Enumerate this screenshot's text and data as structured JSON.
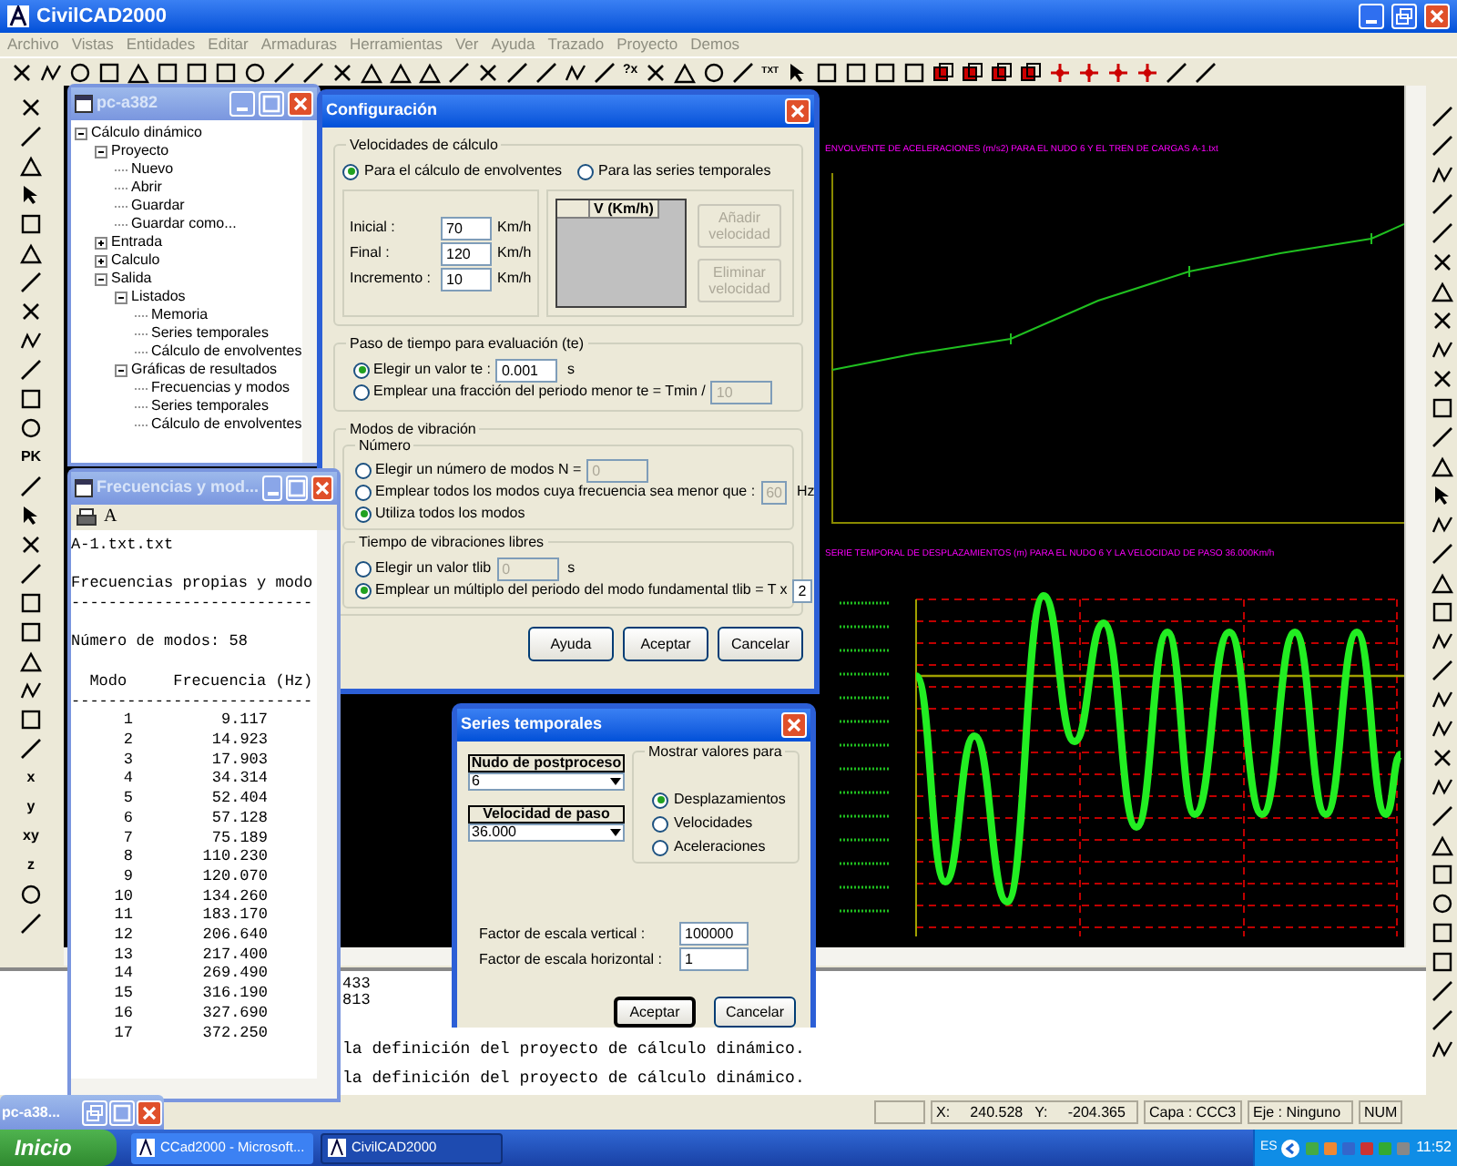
{
  "app": {
    "title": "CivilCAD2000"
  },
  "menu": [
    "Archivo",
    "Vistas",
    "Entidades",
    "Editar",
    "Armaduras",
    "Herramientas",
    "Ver",
    "Ayuda",
    "Trazado",
    "Proyecto",
    "Demos"
  ],
  "toolbar_labels": [
    "?x",
    "TXT"
  ],
  "left_toolbar_labels": [
    "PK",
    "x",
    "y",
    "xy",
    "z"
  ],
  "charts": [
    {
      "title": "ENVOLVENTE DE ACELERACIONES (m/s2) PARA EL NUDO 6 Y EL TREN DE CARGAS A-1.txt",
      "kind": "envelope"
    },
    {
      "title": "SERIE TEMPORAL DE DESPLAZAMIENTOS (m) PARA EL NUDO 6 Y LA VELOCIDAD DE PASO 36.000Km/h",
      "kind": "series"
    }
  ],
  "command_lines": [
    "433",
    "813",
    "la definición del proyecto de cálculo dinámico.",
    "la definición del proyecto de cálculo dinámico."
  ],
  "status_bar": {
    "coords": "X:     240.528   Y:     -204.365",
    "layer": "Capa : CCC3",
    "axis": "Eje : Ninguno",
    "num": "NUM"
  },
  "tree_window": {
    "title": "pc-a382",
    "tree": [
      {
        "label": "Cálculo dinámico",
        "expanded": true,
        "children": [
          {
            "label": "Proyecto",
            "expanded": true,
            "children": [
              {
                "label": "Nuevo"
              },
              {
                "label": "Abrir"
              },
              {
                "label": "Guardar"
              },
              {
                "label": "Guardar como..."
              }
            ]
          },
          {
            "label": "Entrada",
            "expanded": false
          },
          {
            "label": "Calculo",
            "expanded": false
          },
          {
            "label": "Salida",
            "expanded": true,
            "children": [
              {
                "label": "Listados",
                "expanded": true,
                "children": [
                  {
                    "label": "Memoria"
                  },
                  {
                    "label": "Series temporales"
                  },
                  {
                    "label": "Cálculo de envolventes"
                  }
                ]
              },
              {
                "label": "Gráficas de resultados",
                "expanded": true,
                "children": [
                  {
                    "label": "Frecuencias y modos"
                  },
                  {
                    "label": "Series temporales"
                  },
                  {
                    "label": "Cálculo de envolventes"
                  }
                ]
              }
            ]
          }
        ]
      }
    ]
  },
  "freq_window": {
    "title": "Frecuencias y mod...",
    "font_button": "A",
    "blocks": [
      [
        "A-1.txt.txt"
      ],
      [
        "Frecuencias propias y modo",
        "--------------------------"
      ],
      [
        "Número de modos: 58"
      ],
      [
        "  Modo     Frecuencia (Hz)",
        "--------------------------"
      ]
    ],
    "rows": [
      {
        "mode": "1",
        "freq": "9.117"
      },
      {
        "mode": "2",
        "freq": "14.923"
      },
      {
        "mode": "3",
        "freq": "17.903"
      },
      {
        "mode": "4",
        "freq": "34.314"
      },
      {
        "mode": "5",
        "freq": "52.404"
      },
      {
        "mode": "6",
        "freq": "57.128"
      },
      {
        "mode": "7",
        "freq": "75.189"
      },
      {
        "mode": "8",
        "freq": "110.230"
      },
      {
        "mode": "9",
        "freq": "120.070"
      },
      {
        "mode": "10",
        "freq": "134.260"
      },
      {
        "mode": "11",
        "freq": "183.170"
      },
      {
        "mode": "12",
        "freq": "206.640"
      },
      {
        "mode": "13",
        "freq": "217.400"
      },
      {
        "mode": "14",
        "freq": "269.490"
      },
      {
        "mode": "15",
        "freq": "316.190"
      },
      {
        "mode": "16",
        "freq": "327.690"
      },
      {
        "mode": "17",
        "freq": "372.250"
      }
    ]
  },
  "config_dialog": {
    "title": "Configuración",
    "velocities": {
      "legend": "Velocidades de cálculo",
      "options": [
        {
          "label": "Para el cálculo de envolventes",
          "selected": true
        },
        {
          "label": "Para las series temporales",
          "selected": false
        }
      ],
      "fields": [
        {
          "label": "Inicial :",
          "value": "70",
          "unit": "Km/h"
        },
        {
          "label": "Final :",
          "value": "120",
          "unit": "Km/h"
        },
        {
          "label": "Incremento :",
          "value": "10",
          "unit": "Km/h"
        }
      ],
      "list_header": "V (Km/h)",
      "buttons": [
        {
          "label": "Añadir velocidad",
          "disabled": true
        },
        {
          "label": "Eliminar velocidad",
          "disabled": true
        }
      ]
    },
    "time_step": {
      "legend": "Paso de tiempo para evaluación (te)",
      "options": [
        {
          "label": "Elegir un valor  te :",
          "selected": true,
          "value": "0.001",
          "unit": "s"
        },
        {
          "label": "Emplear una fracción del periodo menor  te = Tmin /",
          "selected": false,
          "value": "10"
        }
      ]
    },
    "modes": {
      "legend": "Modos de vibración",
      "sublegend": "Número",
      "options": [
        {
          "label": "Elegir un número de modos  N =",
          "selected": false,
          "value": "0"
        },
        {
          "label": "Emplear todos los modos cuya frecuencia sea menor que :",
          "selected": false,
          "value": "60",
          "unit": "Hz"
        },
        {
          "label": "Utiliza todos los modos",
          "selected": true
        }
      ]
    },
    "free_vibration": {
      "legend": "Tiempo de vibraciones libres",
      "options": [
        {
          "label": "Elegir un valor  tlib",
          "selected": false,
          "value": "0",
          "unit": "s"
        },
        {
          "label": "Emplear un múltiplo del periodo del modo fundamental  tlib = T x",
          "selected": true,
          "value": "2"
        }
      ]
    },
    "buttons": [
      "Ayuda",
      "Aceptar",
      "Cancelar"
    ]
  },
  "series_dialog": {
    "title": "Series temporales",
    "combos": [
      {
        "label": "Nudo de postproceso",
        "value": "6"
      },
      {
        "label": "Velocidad de paso",
        "value": "36.000"
      }
    ],
    "show_group": {
      "legend": "Mostrar valores para",
      "options": [
        {
          "label": "Desplazamientos",
          "selected": true
        },
        {
          "label": "Velocidades",
          "selected": false
        },
        {
          "label": "Aceleraciones",
          "selected": false
        }
      ]
    },
    "fields": [
      {
        "label": "Factor de escala vertical :",
        "value": "100000"
      },
      {
        "label": "Factor de escala horizontal :",
        "value": "1"
      }
    ],
    "buttons": [
      {
        "label": "Aceptar",
        "default": true
      },
      {
        "label": "Cancelar",
        "default": false
      }
    ]
  },
  "minimized_window": {
    "title": "pc-a38..."
  },
  "taskbar": {
    "start": "Inicio",
    "tasks": [
      {
        "label": "CCad2000 - Microsoft...",
        "selected": false
      },
      {
        "label": "CivilCAD2000",
        "selected": true
      }
    ],
    "language": "ES",
    "clock": "11:52"
  }
}
